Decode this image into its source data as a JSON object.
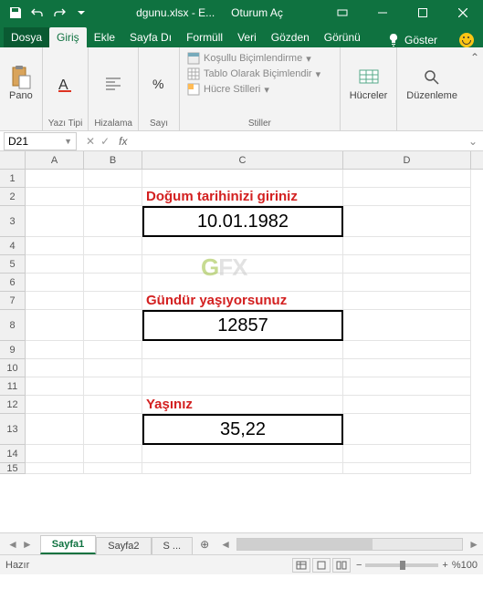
{
  "title": {
    "filename": "dgunu.xlsx  -  E...",
    "signin": "Oturum Aç"
  },
  "tabs": {
    "file": "Dosya",
    "home": "Giriş",
    "insert": "Ekle",
    "layout": "Sayfa Dı",
    "formulas": "Formüll",
    "data": "Veri",
    "review": "Gözden",
    "view": "Görünü",
    "tell": "Göster"
  },
  "ribbon": {
    "clipboard": {
      "label": "Pano",
      "paste": ""
    },
    "font": {
      "label": "Yazı Tipi"
    },
    "align": {
      "label": "Hizalama"
    },
    "number": {
      "label": "Sayı"
    },
    "styles": {
      "label": "Stiller",
      "cond": "Koşullu Biçimlendirme",
      "table": "Tablo Olarak Biçimlendir",
      "cell": "Hücre Stilleri"
    },
    "cells": {
      "label": "Hücreler"
    },
    "editing": {
      "label": "Düzenleme"
    }
  },
  "namebox": "D21",
  "cells": {
    "c2": "Doğum tarihinizi giriniz",
    "c3": "10.01.1982",
    "c7": "Gündür yaşıyorsunuz",
    "c8": "12857",
    "c12": "Yaşınız",
    "c13": "35,22"
  },
  "cols": [
    "A",
    "B",
    "C",
    "D"
  ],
  "rows": [
    "1",
    "2",
    "3",
    "4",
    "5",
    "6",
    "7",
    "8",
    "9",
    "10",
    "11",
    "12",
    "13",
    "14",
    "15"
  ],
  "sheets": {
    "s1": "Sayfa1",
    "s2": "Sayfa2",
    "s3": "S ..."
  },
  "status": {
    "ready": "Hazır",
    "zoom": "%100"
  }
}
